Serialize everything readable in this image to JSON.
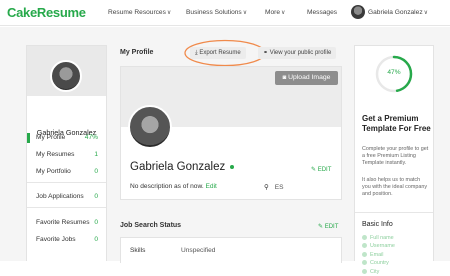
{
  "brand": {
    "logo": "CakeResume",
    "accent": "#27a94b"
  },
  "topnav": {
    "items": [
      "Resume Resources",
      "Business Solutions",
      "More"
    ],
    "messages": "Messages",
    "user": "Gabriela Gonzalez"
  },
  "sidebar": {
    "name": "Gabriela Gonzalez",
    "menu": [
      {
        "label": "My Profile",
        "value": "47%"
      },
      {
        "label": "My Resumes",
        "value": "1"
      },
      {
        "label": "My Portfolio",
        "value": "0"
      },
      {
        "label": "Job Applications",
        "value": "0"
      },
      {
        "label": "Favorite Resumes",
        "value": "0"
      },
      {
        "label": "Favorite Jobs",
        "value": "0"
      }
    ]
  },
  "main": {
    "title": "My Profile",
    "export": "Export Resume",
    "view_public": "View your public profile",
    "upload_image": "Upload Image",
    "profile_name": "Gabriela Gonzalez",
    "edit": "EDIT",
    "description": "No description as of now.",
    "desc_edit": "Edit",
    "location": "ES",
    "job_search_title": "Job Search Status",
    "job_edit": "EDIT",
    "skills_label": "Skills",
    "skills_value": "Unspecified"
  },
  "right": {
    "progress_value": 47,
    "progress_label": "47%",
    "title": "Get a Premium Template For Free",
    "para1": "Complete your profile to get a free Premium Listing Template instantly.",
    "para2": "It also helps us to match you with the ideal company and position.",
    "basic_info": "Basic Info",
    "checks": [
      "Full name",
      "Username",
      "Email",
      "Country",
      "City"
    ]
  }
}
